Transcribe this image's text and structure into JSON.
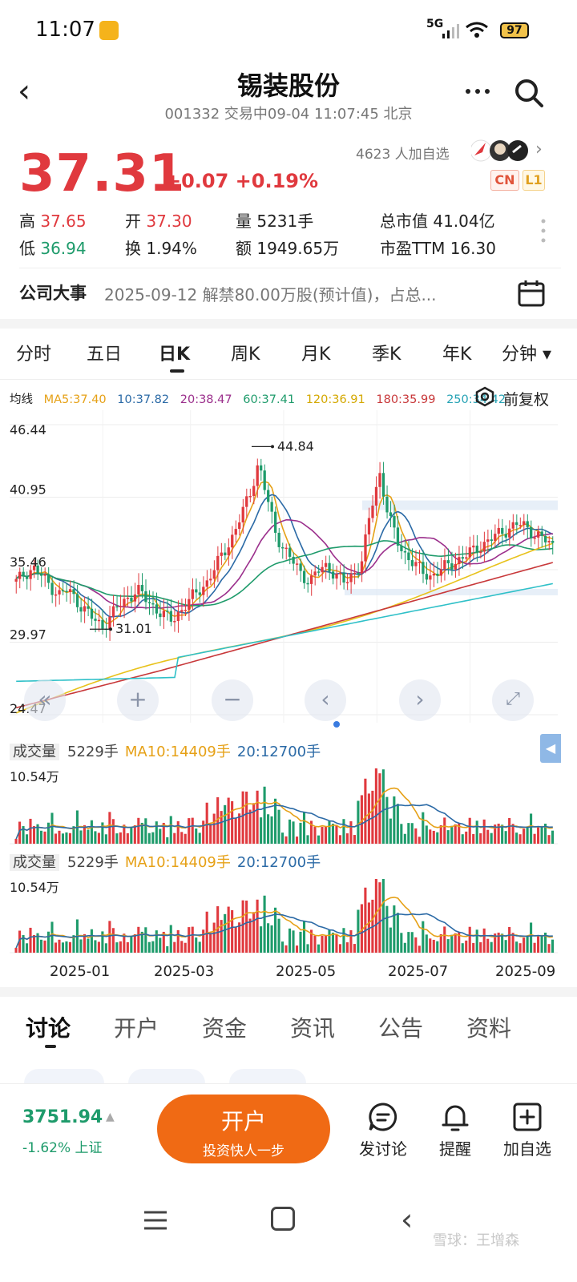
{
  "status_bar": {
    "time": "11:07",
    "network": "5G",
    "battery": "97"
  },
  "header": {
    "name": "锡装股份",
    "code": "001332",
    "status": "交易中09-04 11:07:45 北京"
  },
  "quote": {
    "price": "37.31",
    "change": "+0.07 +0.19%",
    "followers": "4623 人加自选",
    "badge_cn": "CN",
    "badge_l1": "L1",
    "stats": {
      "high_label": "高",
      "high": "37.65",
      "low_label": "低",
      "low": "36.94",
      "open_label": "开",
      "open": "37.30",
      "turnover_label": "换",
      "turnover": "1.94%",
      "volume_label": "量",
      "volume": "5231手",
      "amount_label": "额",
      "amount": "1949.65万",
      "cap_label": "总市值",
      "cap": "41.04亿",
      "pe_label": "市盈TTM",
      "pe": "16.30"
    }
  },
  "events": {
    "title": "公司大事",
    "text": "2025-09-12  解禁80.00万股(预计值)，占总..."
  },
  "period_tabs": [
    "分时",
    "五日",
    "日K",
    "周K",
    "月K",
    "季K",
    "年K",
    "分钟 ▾"
  ],
  "ma_line": {
    "label": "均线",
    "ma5": "MA5:37.40",
    "ma10": "10:37.82",
    "ma20": "20:38.47",
    "ma60": "60:37.41",
    "ma120": "120:36.91",
    "ma180": "180:35.99",
    "ma250": "250:34.42"
  },
  "adjust_label": "前复权",
  "chart_data": [
    {
      "type": "candlestick",
      "y_ticks": [
        "46.44",
        "40.95",
        "35.46",
        "29.97",
        "24.47"
      ],
      "ylim": [
        24.47,
        46.44
      ],
      "annotations": {
        "high": "44.84",
        "low": "31.01"
      },
      "x_ticks": [
        "2025-01",
        "2025-03",
        "2025-05",
        "2025-07",
        "2025-09"
      ],
      "price_path": [
        34.5,
        35.2,
        35.6,
        34.9,
        34.2,
        33.6,
        33.9,
        33.1,
        32.4,
        31.6,
        31.2,
        32.0,
        32.8,
        33.4,
        33.9,
        33.2,
        32.6,
        32.0,
        31.6,
        32.4,
        33.1,
        33.8,
        34.5,
        35.6,
        36.8,
        38.0,
        39.5,
        41.2,
        43.6,
        40.8,
        38.2,
        37.0,
        36.0,
        35.1,
        34.6,
        35.4,
        35.8,
        35.0,
        34.4,
        35.2,
        36.2,
        40.0,
        42.8,
        39.6,
        37.6,
        36.6,
        35.9,
        35.2,
        35.0,
        35.4,
        35.8,
        36.2,
        36.5,
        37.0,
        37.4,
        37.8,
        38.3,
        38.6,
        38.9,
        38.7,
        38.1,
        37.7,
        37.3
      ],
      "colors": {
        "up": "#e0393e",
        "down": "#1e9b6b",
        "ma5": "#e6a117",
        "ma10": "#2b6aa6",
        "ma20": "#9b2f8c",
        "ma60": "#1e9b6b",
        "ma120": "#e8c21b",
        "ma180": "#c8383a",
        "ma250": "#2fc0c8"
      }
    },
    {
      "type": "bar",
      "name": "成交量",
      "header": {
        "box": "成交量",
        "volume": "5229手",
        "ma10": "MA10:14409手",
        "ma20": "20:12700手"
      },
      "max_label": "10.54万"
    },
    {
      "type": "bar",
      "name": "成交量",
      "header": {
        "box": "成交量",
        "volume": "5229手",
        "ma10": "MA10:14409手",
        "ma20": "20:12700手"
      },
      "max_label": "10.54万"
    }
  ],
  "bottom_tabs": [
    "讨论",
    "开户",
    "资金",
    "资讯",
    "公告",
    "资料"
  ],
  "bottom_bar": {
    "index_value": "3751.94",
    "index_change": "-1.62% 上证",
    "open_account": "开户",
    "open_account_sub": "投资快人一步",
    "discuss": "发讨论",
    "remind": "提醒",
    "add_watch": "加自选"
  },
  "watermark": "雪球：王增森"
}
